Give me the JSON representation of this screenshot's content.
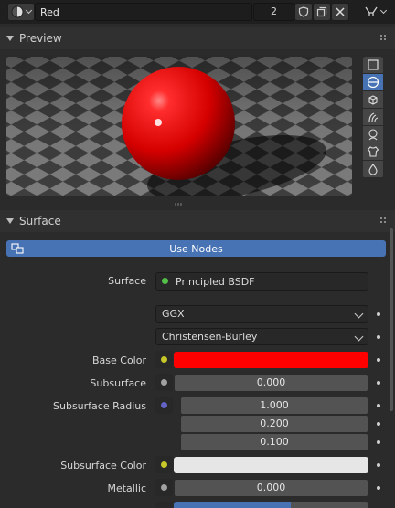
{
  "header": {
    "material_name": "Red",
    "user_count": "2"
  },
  "preview": {
    "title": "Preview",
    "shapes": [
      "flat-icon",
      "sphere-icon",
      "cube-icon",
      "hair-icon",
      "monkey-icon",
      "cloth-icon",
      "fluid-icon"
    ],
    "active_shape": "sphere-icon"
  },
  "surface_panel": {
    "title": "Surface",
    "use_nodes_label": "Use Nodes",
    "surface_label": "Surface",
    "surface_shader": "Principled BSDF",
    "distribution": "GGX",
    "subsurface_method": "Christensen-Burley",
    "base_color_label": "Base Color",
    "base_color": "#ff0000",
    "subsurface_label": "Subsurface",
    "subsurface_value": "0.000",
    "subsurface_radius_label": "Subsurface Radius",
    "subsurface_radius": [
      "1.000",
      "0.200",
      "0.100"
    ],
    "subsurface_color_label": "Subsurface Color",
    "subsurface_color": "#e6e6e6",
    "metallic_label": "Metallic",
    "metallic_value": "0.000"
  },
  "colors": {
    "accent": "#4772b3",
    "socket_green": "#54c04a",
    "socket_yellow": "#c7c729",
    "socket_gray": "#a1a1a1",
    "socket_purple": "#6363c7"
  }
}
